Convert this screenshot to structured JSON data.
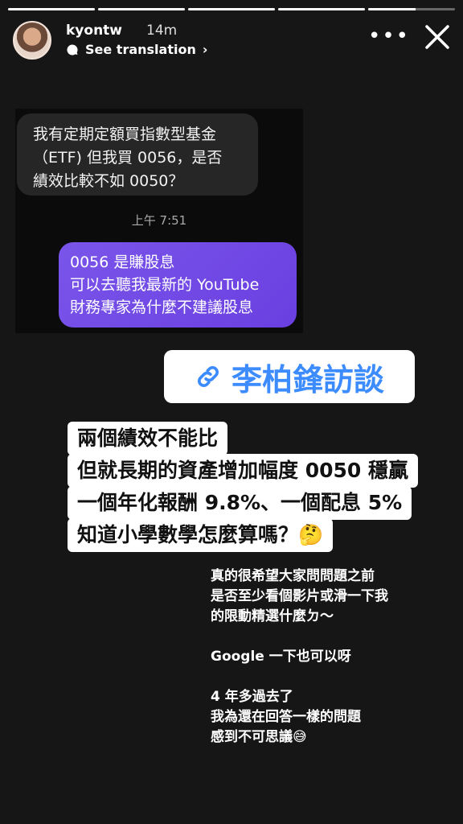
{
  "progress": [
    1,
    1,
    1,
    1,
    0.55
  ],
  "header": {
    "username": "kyontw",
    "time": "14m",
    "translation_label": "See translation",
    "translate_icon": "speech-bubble-icon",
    "more_icon": "more-dots-icon",
    "close_icon": "close-icon"
  },
  "chat": {
    "incoming": "我有定期定額買指數型基金\n（ETF) 但我買 0056，是否\n績效比較不如 0050？",
    "timestamp": "上午 7:51",
    "outgoing": "0056 是賺股息\n可以去聽我最新的 YouTube\n財務專家為什麼不建議股息"
  },
  "link_sticker": {
    "icon": "link-icon",
    "label": "李柏鋒訪談",
    "color": "#3c8cff"
  },
  "answer_lines": [
    "兩個績效不能比",
    "但就長期的資產增加幅度 0050 穩贏",
    "一個年化報酬 9.8%、一個配息 5%",
    "知道小學數學怎麼算嗎？🤔"
  ],
  "note": "真的很希望大家問問題之前\n是否至少看個影片或滑一下我\n的限動精選什麼ㄉ～\n\nGoogle 一下也可以呀\n\n4 年多過去了\n我為還在回答一樣的問題\n感到不可思議😅"
}
